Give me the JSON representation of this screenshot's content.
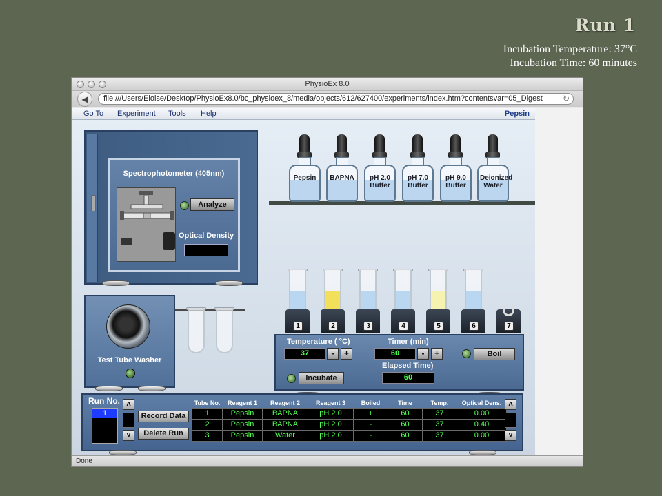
{
  "slide": {
    "title": "Run 1",
    "line1": "Incubation Temperature: 37°C",
    "line2": "Incubation Time: 60 minutes"
  },
  "browser": {
    "window_title": "PhysioEx 8.0",
    "url": "file:///Users/Eloise/Desktop/PhysioEx8.0/bc_physioex_8/media/objects/612/627400/experiments/index.htm?contentsvar=05_Digest",
    "status": "Done"
  },
  "menu": {
    "items": [
      "Go To",
      "Experiment",
      "Tools",
      "Help"
    ],
    "app_name": "Pepsin"
  },
  "spectrophotometer": {
    "label": "Spectrophotometer (405nm)",
    "analyze_label": "Analyze",
    "od_label": "Optical Density",
    "od_value": ""
  },
  "reagents": [
    {
      "line1": "Pepsin",
      "line2": ""
    },
    {
      "line1": "BAPNA",
      "line2": ""
    },
    {
      "line1": "pH 2.0",
      "line2": "Buffer"
    },
    {
      "line1": "pH 7.0",
      "line2": "Buffer"
    },
    {
      "line1": "pH 9.0",
      "line2": "Buffer"
    },
    {
      "line1": "Deionized",
      "line2": "Water"
    }
  ],
  "tubes": [
    {
      "number": "1",
      "fill": "light-blue",
      "fill_level": 0.55
    },
    {
      "number": "2",
      "fill": "yellow",
      "fill_level": 0.55
    },
    {
      "number": "3",
      "fill": "light-blue",
      "fill_level": 0.55
    },
    {
      "number": "4",
      "fill": "light-blue",
      "fill_level": 0.55
    },
    {
      "number": "5",
      "fill": "pale-yellow",
      "fill_level": 0.55
    },
    {
      "number": "6",
      "fill": "light-blue",
      "fill_level": 0.55
    },
    {
      "number": "7",
      "fill": "empty",
      "fill_level": 0
    }
  ],
  "colors": {
    "light-blue": "#b9d7f0",
    "yellow": "#f2e05a",
    "pale-yellow": "#f6f2b0",
    "lcd_text": "#4dff4d",
    "panel_blue": "#4b6a92"
  },
  "washer": {
    "label": "Test Tube Washer"
  },
  "incubator": {
    "temperature_label": "Temperature ( °C)",
    "temperature_value": "37",
    "timer_label": "Timer (min)",
    "timer_value": "60",
    "boil_label": "Boil",
    "incubate_label": "Incubate",
    "elapsed_label": "Elapsed Time)",
    "elapsed_value": "60",
    "minus": "-",
    "plus": "+"
  },
  "recorder": {
    "run_label": "Run No.",
    "runs": [
      "1"
    ],
    "record_label": "Record Data",
    "delete_label": "Delete Run",
    "up_arrow": "ʌ",
    "down_arrow": "v",
    "columns": [
      "Tube No.",
      "Reagent 1",
      "Reagent 2",
      "Reagent 3",
      "Boiled",
      "Time",
      "Temp.",
      "Optical Dens."
    ],
    "rows": [
      [
        "1",
        "Pepsin",
        "BAPNA",
        "pH 2.0",
        "+",
        "60",
        "37",
        "0.00"
      ],
      [
        "2",
        "Pepsin",
        "BAPNA",
        "pH 2.0",
        "-",
        "60",
        "37",
        "0.40"
      ],
      [
        "3",
        "Pepsin",
        "Water",
        "pH 2.0",
        "-",
        "60",
        "37",
        "0.00"
      ]
    ]
  }
}
